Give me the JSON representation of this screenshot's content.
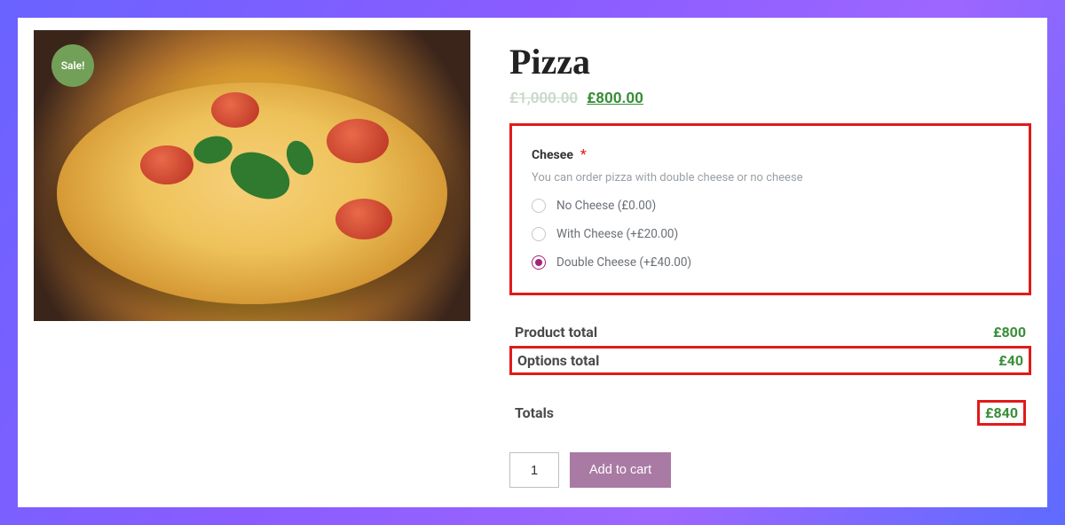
{
  "product": {
    "title": "Pizza",
    "sale_badge": "Sale!",
    "price_old": "£1,000.00",
    "price_new": "£800.00"
  },
  "options": {
    "label": "Chesee",
    "required_marker": "*",
    "help": "You can order pizza with double cheese or no cheese",
    "items": [
      {
        "label": "No Cheese (£0.00)",
        "selected": false
      },
      {
        "label": "With Cheese (+£20.00)",
        "selected": false
      },
      {
        "label": "Double Cheese (+£40.00)",
        "selected": true
      }
    ]
  },
  "totals": {
    "product_label": "Product total",
    "product_amount": "£800",
    "options_label": "Options total",
    "options_amount": "£40",
    "grand_label": "Totals",
    "grand_amount": "£840"
  },
  "cart": {
    "qty": "1",
    "add_label": "Add to cart"
  }
}
